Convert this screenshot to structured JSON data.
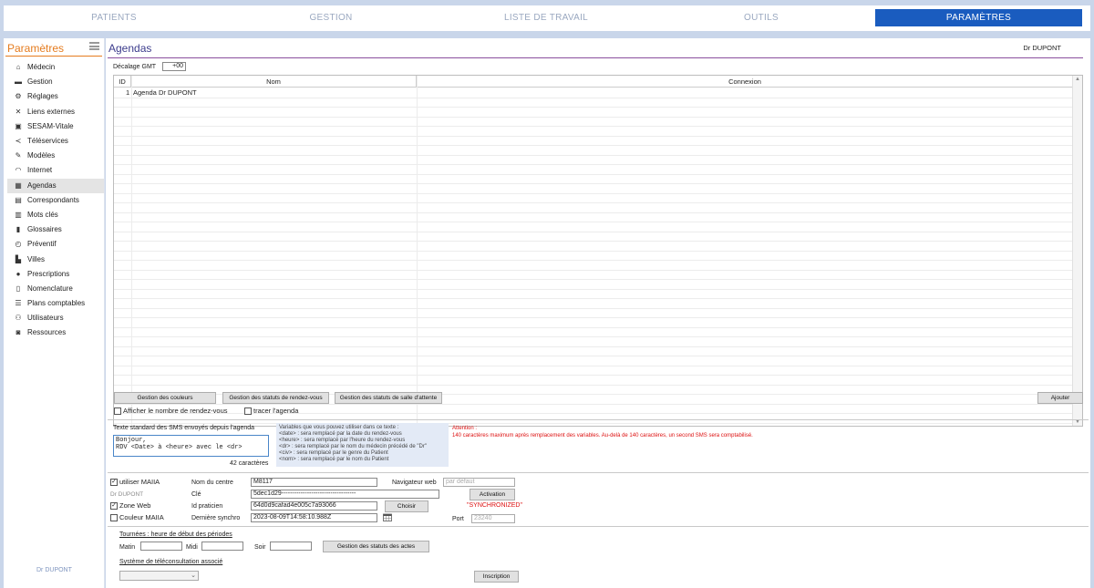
{
  "topnav": {
    "tabs": [
      {
        "label": "PATIENTS"
      },
      {
        "label": "GESTION"
      },
      {
        "label": "LISTE DE TRAVAIL"
      },
      {
        "label": "OUTILS"
      },
      {
        "label": "PARAMÈTRES"
      }
    ],
    "active_index": 4
  },
  "sidebar": {
    "title": "Paramètres",
    "items": [
      {
        "label": "Médecin",
        "icon": "home-icon"
      },
      {
        "label": "Gestion",
        "icon": "car-icon"
      },
      {
        "label": "Réglages",
        "icon": "gears-icon"
      },
      {
        "label": "Liens externes",
        "icon": "expand-icon"
      },
      {
        "label": "SESAM-Vitale",
        "icon": "card-icon"
      },
      {
        "label": "Téléservices",
        "icon": "share-icon"
      },
      {
        "label": "Modèles",
        "icon": "edit-icon"
      },
      {
        "label": "Internet",
        "icon": "wifi-icon"
      },
      {
        "label": "Agendas",
        "icon": "calendar-icon"
      },
      {
        "label": "Correspondants",
        "icon": "contact-book-icon"
      },
      {
        "label": "Mots clés",
        "icon": "bar-chart-icon"
      },
      {
        "label": "Glossaires",
        "icon": "book-icon"
      },
      {
        "label": "Préventif",
        "icon": "clock-icon"
      },
      {
        "label": "Villes",
        "icon": "building-icon"
      },
      {
        "label": "Prescriptions",
        "icon": "pills-icon"
      },
      {
        "label": "Nomenclature",
        "icon": "document-icon"
      },
      {
        "label": "Plans comptables",
        "icon": "list-icon"
      },
      {
        "label": "Utilisateurs",
        "icon": "users-icon"
      },
      {
        "label": "Ressources",
        "icon": "vehicle-icon"
      }
    ],
    "selected_index": 8,
    "footer_user": "Dr DUPONT"
  },
  "main": {
    "title": "Agendas",
    "user": "Dr DUPONT",
    "gmt_label": "Décalage GMT",
    "gmt_value": "+00",
    "table": {
      "columns": [
        "ID",
        "Nom",
        "Connexion"
      ],
      "rows": [
        {
          "id": "1",
          "nom": "Agenda Dr DUPONT",
          "connexion": ""
        }
      ]
    },
    "buttons": {
      "couleurs": "Gestion des couleurs",
      "statuts_rdv": "Gestion des statuts de rendez-vous",
      "statuts_salle": "Gestion des statuts de salle d'attente",
      "ajouter": "Ajouter"
    },
    "checks": {
      "afficher_nombre": {
        "label": "Afficher le nombre de rendez-vous",
        "checked": false
      },
      "tracer": {
        "label": "tracer l'agenda",
        "checked": false
      }
    },
    "sms": {
      "label": "Texte standard des SMS envoyés depuis l'agenda",
      "text": "Bonjour,\nRDV <Date> à <heure> avec le <dr>",
      "count": "42 caractères",
      "vars": [
        "Variables que vous pouvez utiliser dans ce texte :",
        "<date> : sera remplacé par la date du rendez-vous",
        "<heure> : sera remplacé par l'heure du rendez-vous",
        "<dr> : sera remplacé par le nom du médecin précédé de \"Dr\"",
        "<civ> : sera remplacé par le genre du Patient",
        "<nom> : sera remplacé par le nom du Patient"
      ],
      "attention_title": "Attention :",
      "attention_text": "140 caractères maximum après remplacement des variables. Au-delà de 140 caractères, un second SMS sera comptabilisé."
    },
    "maiia": {
      "utiliser": {
        "label": "utiliser MAIIA",
        "checked": true
      },
      "user": "Dr DUPONT",
      "zone_web": {
        "label": "Zone Web",
        "checked": true
      },
      "couleur": {
        "label": "Couleur MAIIA",
        "checked": false
      },
      "nom_centre_label": "Nom du centre",
      "nom_centre_value": "M8117",
      "cle_label": "Clé",
      "cle_value": "5dec1d29-----------------------------------",
      "id_praticien_label": "Id praticien",
      "id_praticien_value": "64d0d9cafad4e005c7a93066",
      "derniere_synchro_label": "Dernière synchro",
      "derniere_synchro_value": "2023-08-09T14:58:10.988Z",
      "navigateur_label": "Navigateur web",
      "navigateur_placeholder": "par défaut",
      "activation_button": "Activation",
      "choisir_button": "Choisir",
      "status": "\"SYNCHRONIZED\"",
      "port_label": "Port",
      "port_placeholder": "23240"
    },
    "tournees": {
      "title": "Tournées : heure de début des périodes",
      "matin_label": "Matin",
      "midi_label": "Midi",
      "soir_label": "Soir",
      "matin_value": "",
      "midi_value": "",
      "soir_value": "",
      "statuts_actes_button": "Gestion des statuts des actes"
    },
    "teleconsult": {
      "title": "Système de téléconsultation associé",
      "selected": "",
      "inscription_button": "Inscription"
    }
  },
  "colors": {
    "accent": "#1a5cbf",
    "sidebar_title": "#e57c1f",
    "page_title": "#3c3c8c",
    "divider": "#8a4f9e",
    "warning": "#dd1111"
  }
}
